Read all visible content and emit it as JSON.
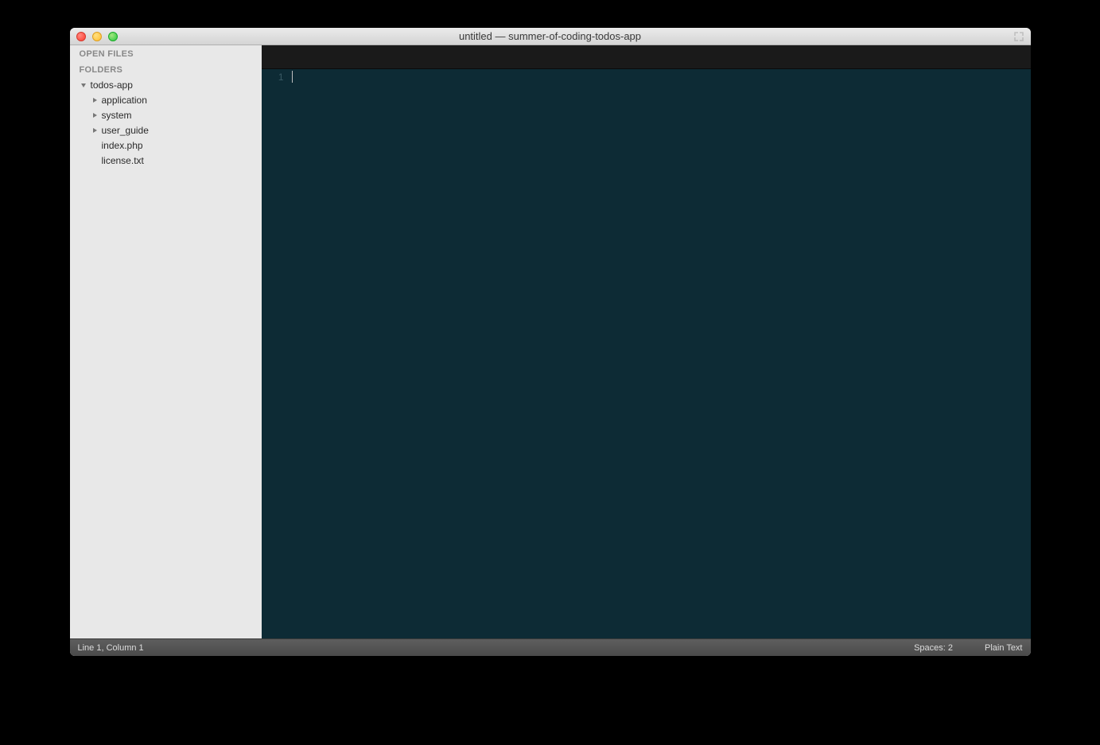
{
  "window": {
    "title": "untitled — summer-of-coding-todos-app"
  },
  "sidebar": {
    "open_files_header": "OPEN FILES",
    "folders_header": "FOLDERS",
    "tree": {
      "root": {
        "name": "todos-app",
        "children": [
          {
            "name": "application",
            "type": "folder"
          },
          {
            "name": "system",
            "type": "folder"
          },
          {
            "name": "user_guide",
            "type": "folder"
          },
          {
            "name": "index.php",
            "type": "file"
          },
          {
            "name": "license.txt",
            "type": "file"
          }
        ]
      }
    }
  },
  "editor": {
    "line_number": "1"
  },
  "statusbar": {
    "position": "Line 1, Column 1",
    "indentation": "Spaces: 2",
    "syntax": "Plain Text"
  }
}
